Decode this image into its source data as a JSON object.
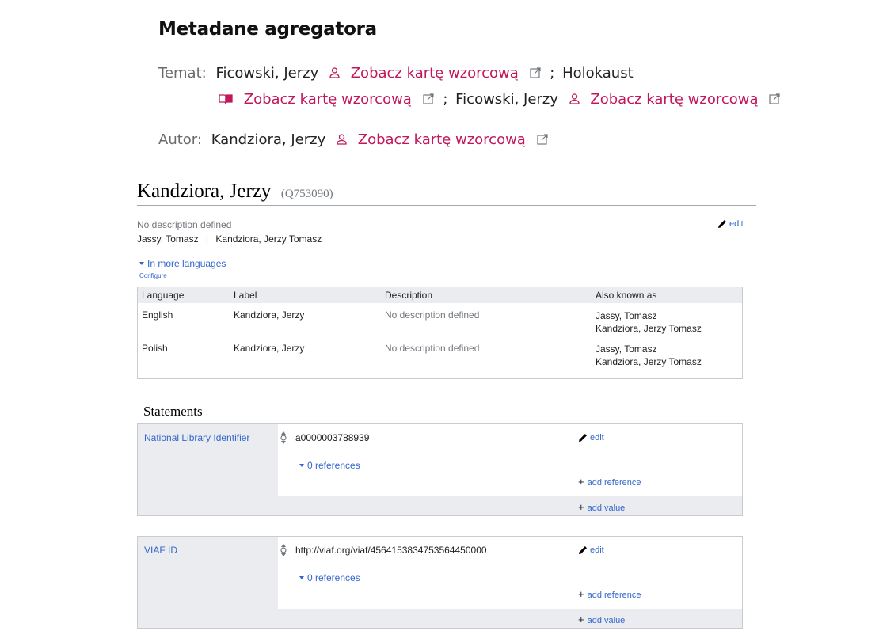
{
  "aggregator": {
    "title": "Metadane agregatora",
    "subject_label": "Temat:",
    "subjects": [
      "Ficowski, Jerzy",
      "Holokaust",
      "Ficowski, Jerzy"
    ],
    "authority_link": "Zobacz kartę wzorcową",
    "separator": ";",
    "author_label": "Autor:",
    "author": "Kandziora, Jerzy",
    "link_color": "#c2185b"
  },
  "entity": {
    "title": "Kandziora, Jerzy",
    "id": "(Q753090)",
    "description": "No description defined",
    "aliases": [
      "Jassy, Tomasz",
      "Kandziora, Jerzy Tomasz"
    ],
    "alias_separator": "|",
    "edit_label": "edit",
    "more_languages": "In more languages",
    "configure": "Configure",
    "table": {
      "headers": [
        "Language",
        "Label",
        "Description",
        "Also known as"
      ],
      "rows": [
        {
          "language": "English",
          "label": "Kandziora, Jerzy",
          "description": "No description defined",
          "aliases": [
            "Jassy, Tomasz",
            "Kandziora, Jerzy Tomasz"
          ]
        },
        {
          "language": "Polish",
          "label": "Kandziora, Jerzy",
          "description": "No description defined",
          "aliases": [
            "Jassy, Tomasz",
            "Kandziora, Jerzy Tomasz"
          ]
        }
      ]
    }
  },
  "statements": {
    "title": "Statements",
    "items": [
      {
        "property": "National Library Identifier",
        "value": "a0000003788939",
        "references": "0 references",
        "edit": "edit",
        "add_reference": "add reference",
        "add_value": "add value"
      },
      {
        "property": "VIAF ID",
        "value": "http://viaf.org/viaf/4564153834753564450000",
        "references": "0 references",
        "edit": "edit",
        "add_reference": "add reference",
        "add_value": "add value"
      }
    ]
  },
  "colors": {
    "link_blue": "#3366cc",
    "muted_grey": "#72777d",
    "panel_grey": "#eaecf0"
  }
}
